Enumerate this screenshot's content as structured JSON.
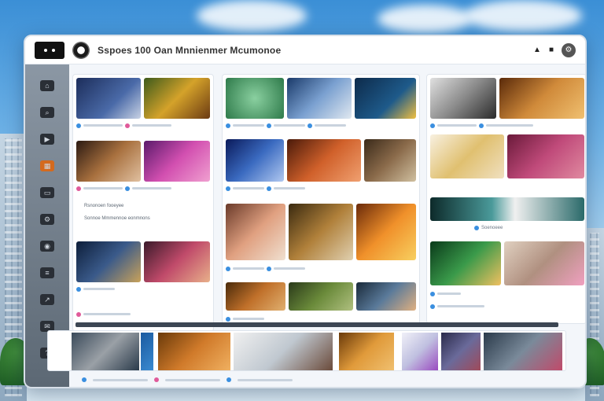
{
  "app": {
    "title": "Sspoes  100  Oan Mnnienmer  Mcumonoe",
    "badge_icon": "menu-dots-icon",
    "logo_icon": "camera-logo-icon"
  },
  "topbar": {
    "right_icons": [
      "bell-icon",
      "user-icon",
      "settings-icon"
    ]
  },
  "sidebar": {
    "icons": [
      "home-icon",
      "search-icon",
      "video-icon",
      "grid-icon",
      "folder-icon",
      "settings-icon",
      "camera-icon",
      "list-icon",
      "share-icon",
      "chat-icon",
      "help-icon"
    ]
  },
  "colors": {
    "accent": "#3a8fe0",
    "sidebar": "#5c6874",
    "panel": "#ffffff"
  },
  "left_panel": {
    "notices": [
      "Rsnonoen fooeyee",
      "Sonnoe Mmmennoe eonmnons"
    ]
  },
  "right_panel": {
    "caption": "Soenoeee"
  }
}
